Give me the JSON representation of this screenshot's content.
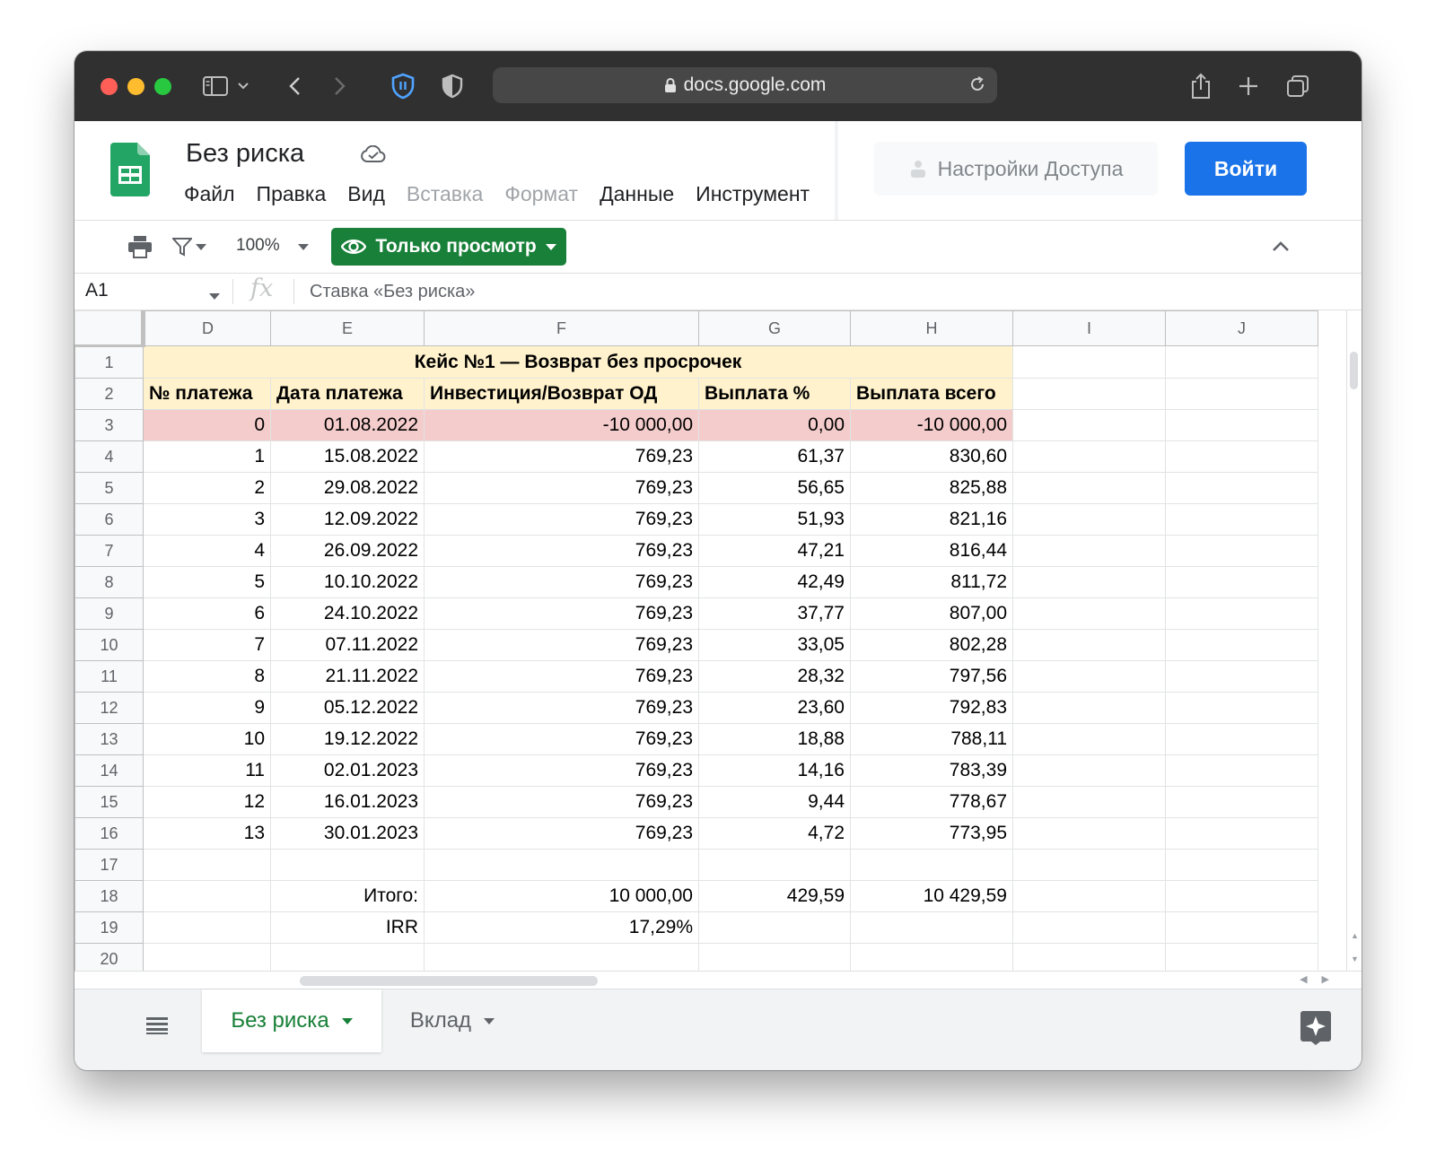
{
  "browser": {
    "url": "docs.google.com"
  },
  "doc": {
    "title": "Без риска",
    "menu": [
      "Файл",
      "Правка",
      "Вид",
      "Вставка",
      "Формат",
      "Данные",
      "Инструмент"
    ],
    "share_label": "Настройки Доступа",
    "login_label": "Войти"
  },
  "toolbar": {
    "zoom": "100%",
    "view_mode": "Только просмотр"
  },
  "formula_bar": {
    "cell_ref": "A1",
    "formula": "Ставка «Без риска»"
  },
  "sheet": {
    "columns": [
      "D",
      "E",
      "F",
      "G",
      "H",
      "I",
      "J"
    ],
    "title": "Кейс №1 — Возврат без просрочек",
    "headers": [
      "№ платежа",
      "Дата платежа",
      "Инвестиция/Возврат ОД",
      "Выплата %",
      "Выплата всего"
    ],
    "rows": [
      [
        "0",
        "01.08.2022",
        "-10 000,00",
        "0,00",
        "-10 000,00"
      ],
      [
        "1",
        "15.08.2022",
        "769,23",
        "61,37",
        "830,60"
      ],
      [
        "2",
        "29.08.2022",
        "769,23",
        "56,65",
        "825,88"
      ],
      [
        "3",
        "12.09.2022",
        "769,23",
        "51,93",
        "821,16"
      ],
      [
        "4",
        "26.09.2022",
        "769,23",
        "47,21",
        "816,44"
      ],
      [
        "5",
        "10.10.2022",
        "769,23",
        "42,49",
        "811,72"
      ],
      [
        "6",
        "24.10.2022",
        "769,23",
        "37,77",
        "807,00"
      ],
      [
        "7",
        "07.11.2022",
        "769,23",
        "33,05",
        "802,28"
      ],
      [
        "8",
        "21.11.2022",
        "769,23",
        "28,32",
        "797,56"
      ],
      [
        "9",
        "05.12.2022",
        "769,23",
        "23,60",
        "792,83"
      ],
      [
        "10",
        "19.12.2022",
        "769,23",
        "18,88",
        "788,11"
      ],
      [
        "11",
        "02.01.2023",
        "769,23",
        "14,16",
        "783,39"
      ],
      [
        "12",
        "16.01.2023",
        "769,23",
        "9,44",
        "778,67"
      ],
      [
        "13",
        "30.01.2023",
        "769,23",
        "4,72",
        "773,95"
      ]
    ],
    "total_label": "Итого:",
    "totals": [
      "10 000,00",
      "429,59",
      "10 429,59"
    ],
    "irr_label": "IRR",
    "irr_value": "17,29%"
  },
  "tabs": [
    {
      "label": "Без риска",
      "active": true
    },
    {
      "label": "Вклад",
      "active": false
    }
  ],
  "colors": {
    "title_bg": "#fff2cc",
    "first_row_bg": "#f4cccc",
    "accent_green": "#188038",
    "login_blue": "#1a73e8"
  }
}
